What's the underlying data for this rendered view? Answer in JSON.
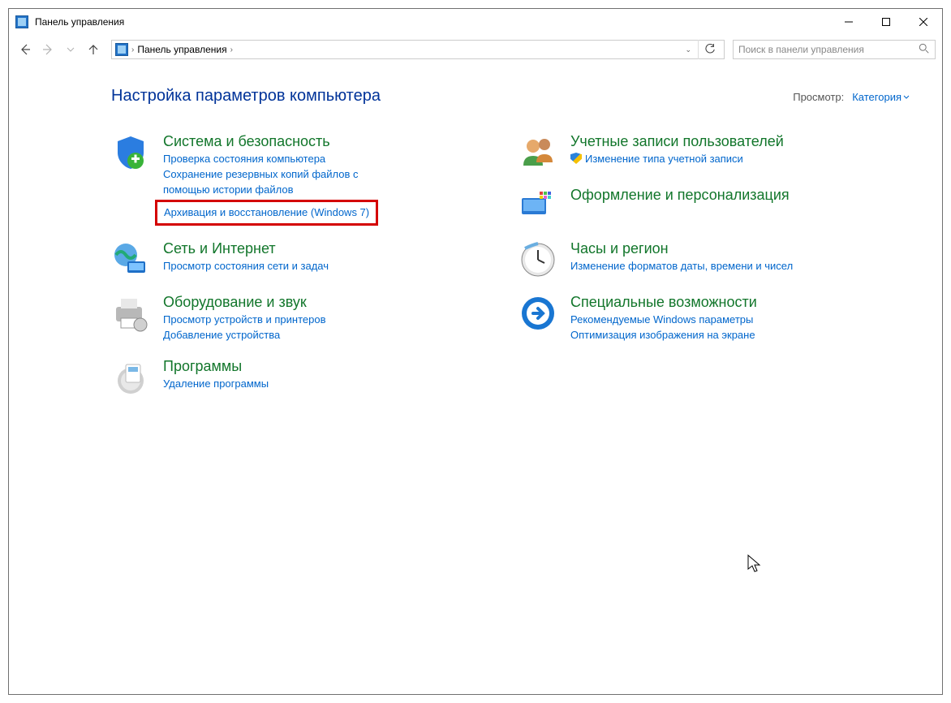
{
  "window": {
    "title": "Панель управления"
  },
  "address": {
    "path": "Панель управления"
  },
  "search": {
    "placeholder": "Поиск в панели управления"
  },
  "header": {
    "title": "Настройка параметров компьютера",
    "view_label": "Просмотр:",
    "view_value": "Категория"
  },
  "left": {
    "security": {
      "title": "Система и безопасность",
      "link1": "Проверка состояния компьютера",
      "link2": "Сохранение резервных копий файлов с помощью истории файлов",
      "link3": "Архивация и восстановление (Windows 7)"
    },
    "network": {
      "title": "Сеть и Интернет",
      "link1": "Просмотр состояния сети и задач"
    },
    "hardware": {
      "title": "Оборудование и звук",
      "link1": "Просмотр устройств и принтеров",
      "link2": "Добавление устройства"
    },
    "programs": {
      "title": "Программы",
      "link1": "Удаление программы"
    }
  },
  "right": {
    "users": {
      "title": "Учетные записи пользователей",
      "link1": "Изменение типа учетной записи"
    },
    "appearance": {
      "title": "Оформление и персонализация"
    },
    "clock": {
      "title": "Часы и регион",
      "link1": "Изменение форматов даты, времени и чисел"
    },
    "access": {
      "title": "Специальные возможности",
      "link1": "Рекомендуемые Windows параметры",
      "link2": "Оптимизация изображения на экране"
    }
  }
}
